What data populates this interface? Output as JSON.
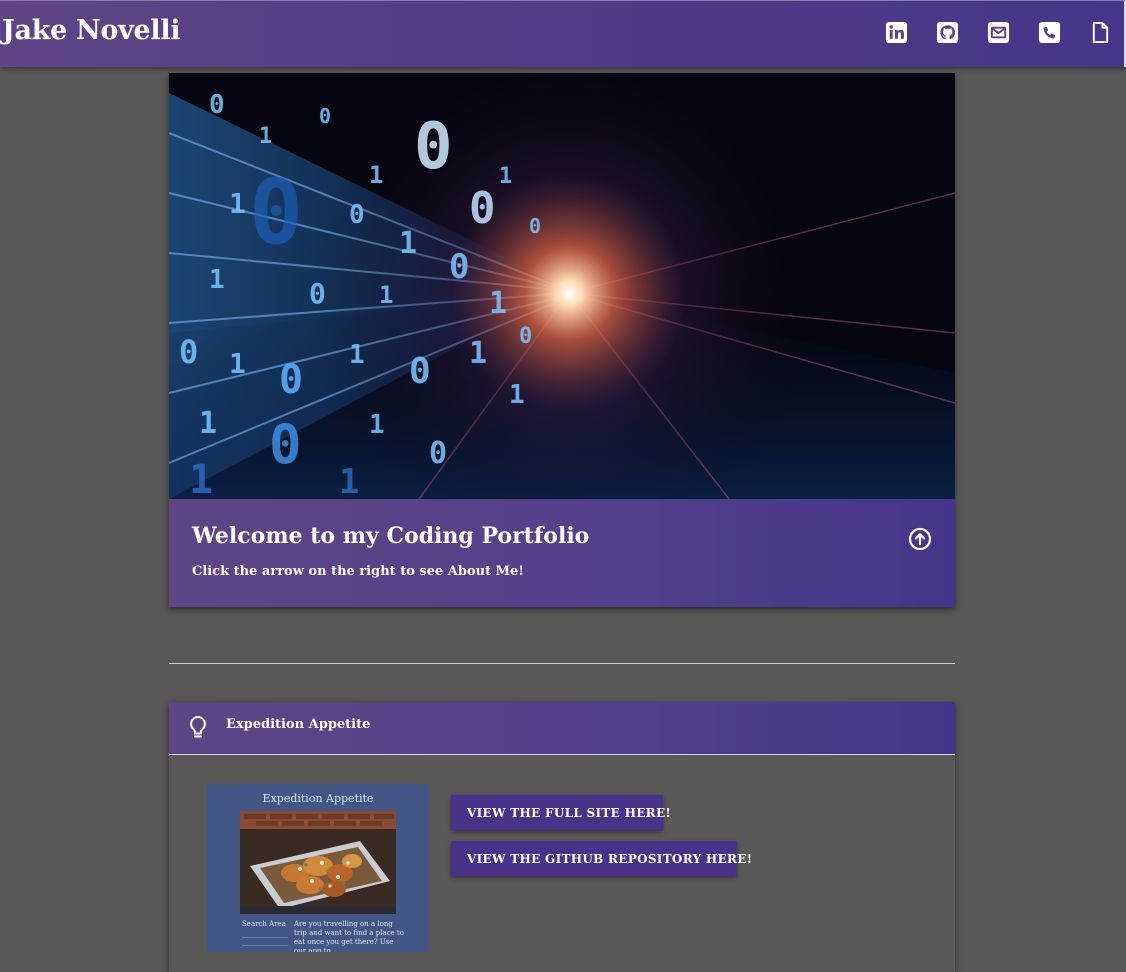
{
  "header": {
    "title": "Jake Novelli",
    "icons": [
      "linkedin-icon",
      "github-icon",
      "email-icon",
      "phone-icon",
      "resume-document-icon"
    ]
  },
  "hero": {
    "title": "Welcome to my Coding Portfolio",
    "subtitle": "Click the arrow on the right to see About Me!",
    "image": "binary-code-light-tunnel-image",
    "arrow_icon": "arrow-up-circle-icon"
  },
  "project": {
    "title": "Expedition Appetite",
    "icon": "lightbulb-icon",
    "screenshot": {
      "title": "Expedition Appetite",
      "search_label": "Search Area",
      "body": "Are you travelling on a long trip and want to find a place to eat once you get there? Use our app to"
    },
    "site_button": "VIEW THE FULL SITE HERE!",
    "repo_button": "VIEW THE GITHUB REPOSITORY HERE!"
  },
  "colors": {
    "page_bg": "#595857",
    "accent": "#52408a",
    "button": "#47338a",
    "text": "#ffffff"
  }
}
